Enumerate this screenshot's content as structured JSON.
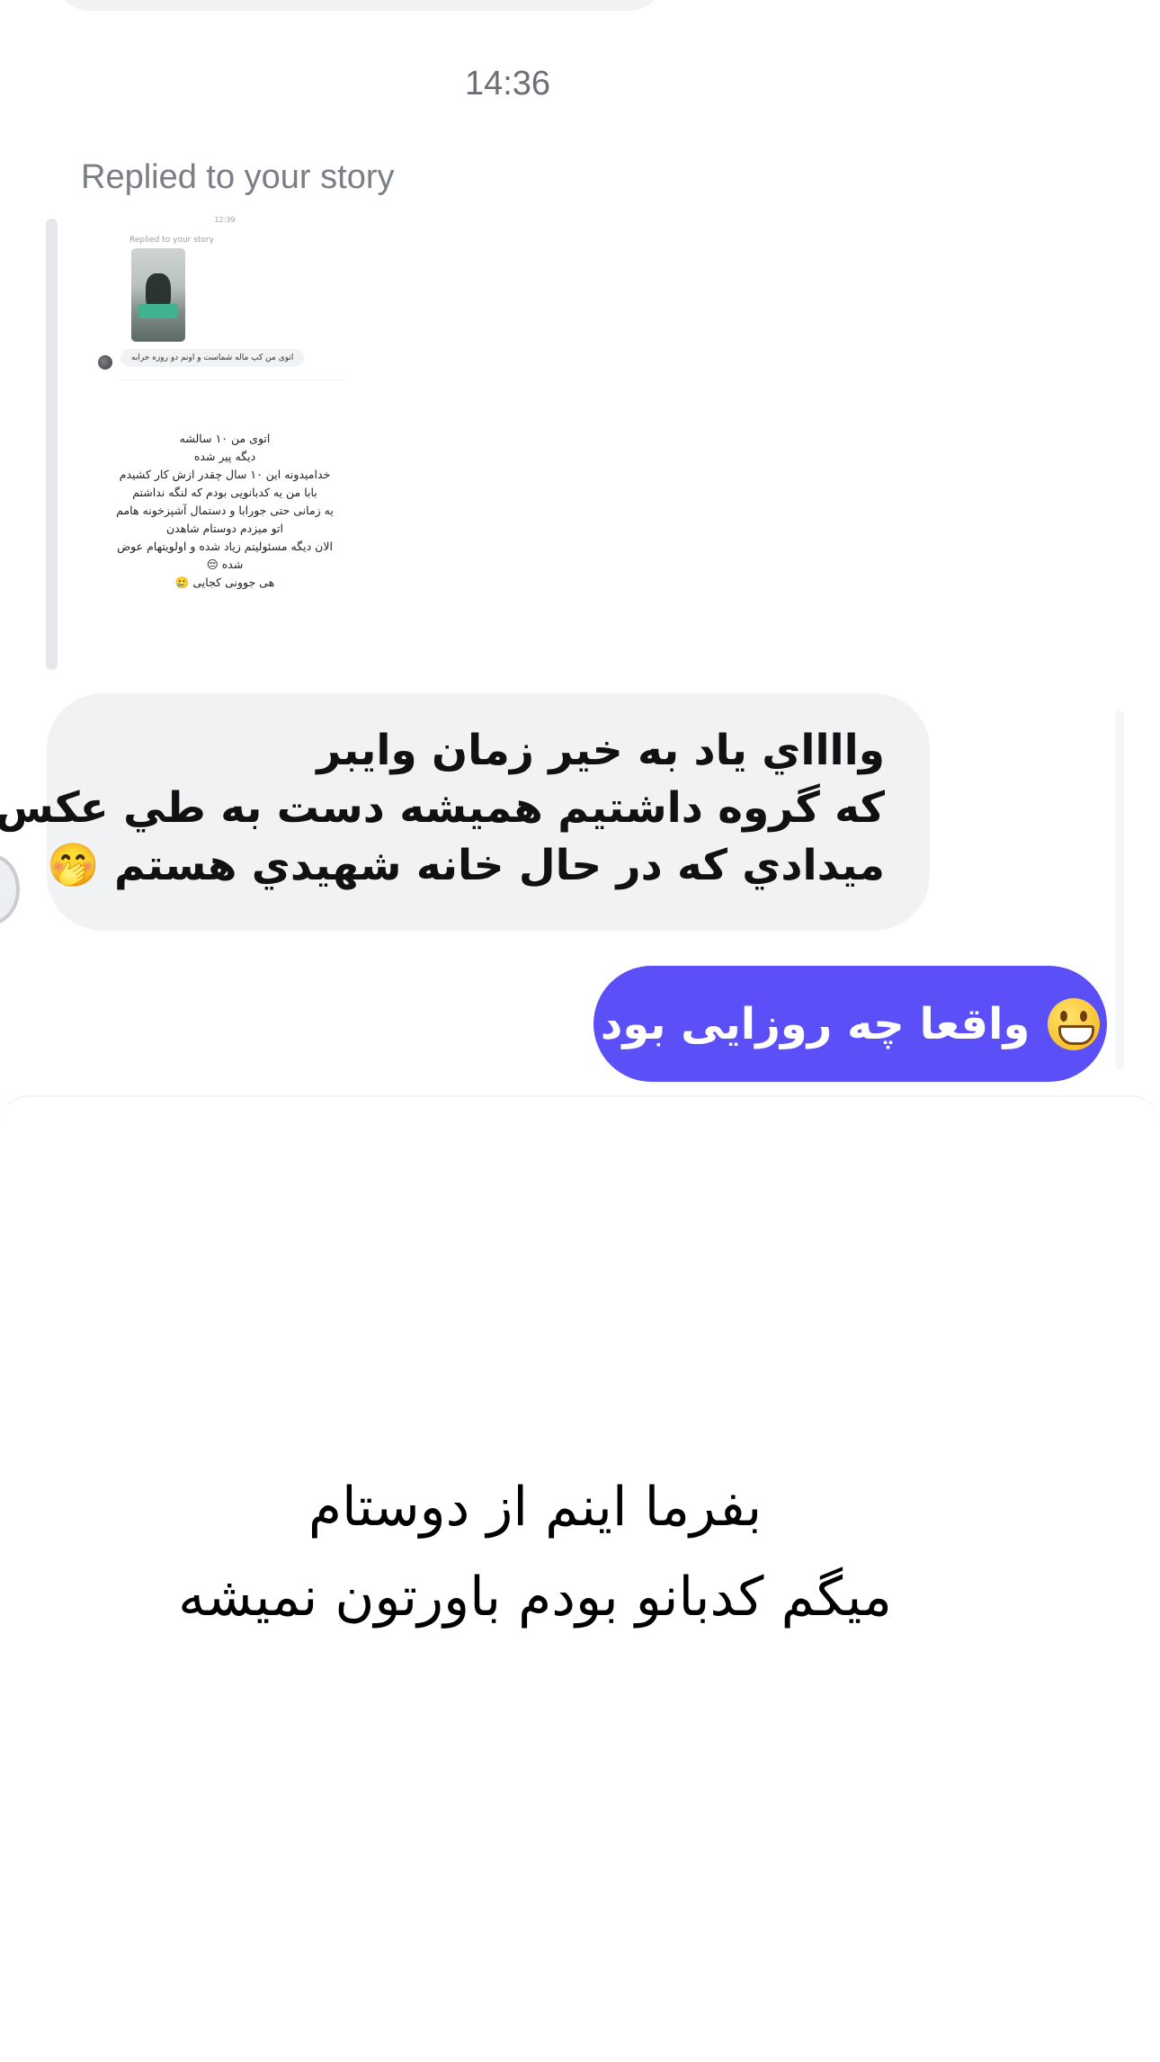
{
  "chat": {
    "timestamp": "14:36",
    "replied_label": "Replied to your story",
    "story": {
      "time": "12:39",
      "replied_label": "Replied to your story",
      "reply_message": "اتوی من کپ ماله شماست و اونم دو روزه خرابه",
      "caption_lines": [
        "اتوی من ۱۰ سالشه",
        "دیگه پیر شده",
        "خدامیدونه این ۱۰ سال چقدر ازش کار کشیدم",
        "بابا من یه کدبانویی بودم که لنگه نداشتم",
        "یه زمانی حتی جورابا و دستمال آشپزخونه هامم",
        "اتو میزدم دوستام شاهدن",
        "الان دیگه مسئولیتم زیاد شده و اولویتهام عوض",
        "شده 😔",
        "هی جوونی کجایی 🥲"
      ]
    },
    "received_message": {
      "lines": [
        "وااااي ياد به خير زمان وايبر",
        "كه گروه داشتيم هميشه دست به طي عكس",
        "ميدادي كه در حال خانه شهيدي هستم"
      ],
      "emoji": "hand-over-mouth-emoji"
    },
    "sent_message": {
      "text": "واقعا چه روزایی بود",
      "emoji": "grinning-face-emoji",
      "color": "#5b4ff7"
    }
  },
  "caption": {
    "lines": [
      "بفرما اینم از دوستام",
      "میگم کدبانو بودم باورتون نمیشه"
    ]
  }
}
